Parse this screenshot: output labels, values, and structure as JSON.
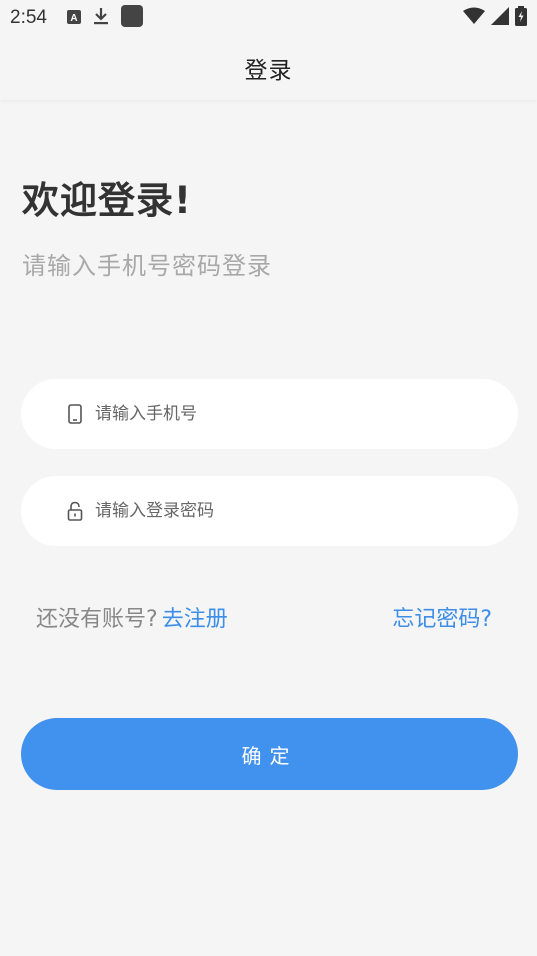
{
  "status_bar": {
    "time": "2:54",
    "icons_left": [
      "a-notification-icon",
      "download-icon",
      "app-square-icon"
    ],
    "icons_right": [
      "wifi-icon",
      "signal-icon",
      "battery-icon"
    ]
  },
  "header": {
    "title": "登录"
  },
  "welcome": {
    "title": "欢迎登录!",
    "subtitle": "请输入手机号密码登录"
  },
  "form": {
    "phone": {
      "value": "",
      "placeholder": "请输入手机号",
      "icon": "phone-icon"
    },
    "password": {
      "value": "",
      "placeholder": "请输入登录密码",
      "icon": "lock-icon"
    }
  },
  "links": {
    "no_account": "还没有账号?",
    "register": "去注册",
    "forgot": "忘记密码?"
  },
  "actions": {
    "confirm": "确定"
  },
  "colors": {
    "accent": "#4191ee",
    "link": "#3d8ee8",
    "background": "#f5f5f5"
  }
}
